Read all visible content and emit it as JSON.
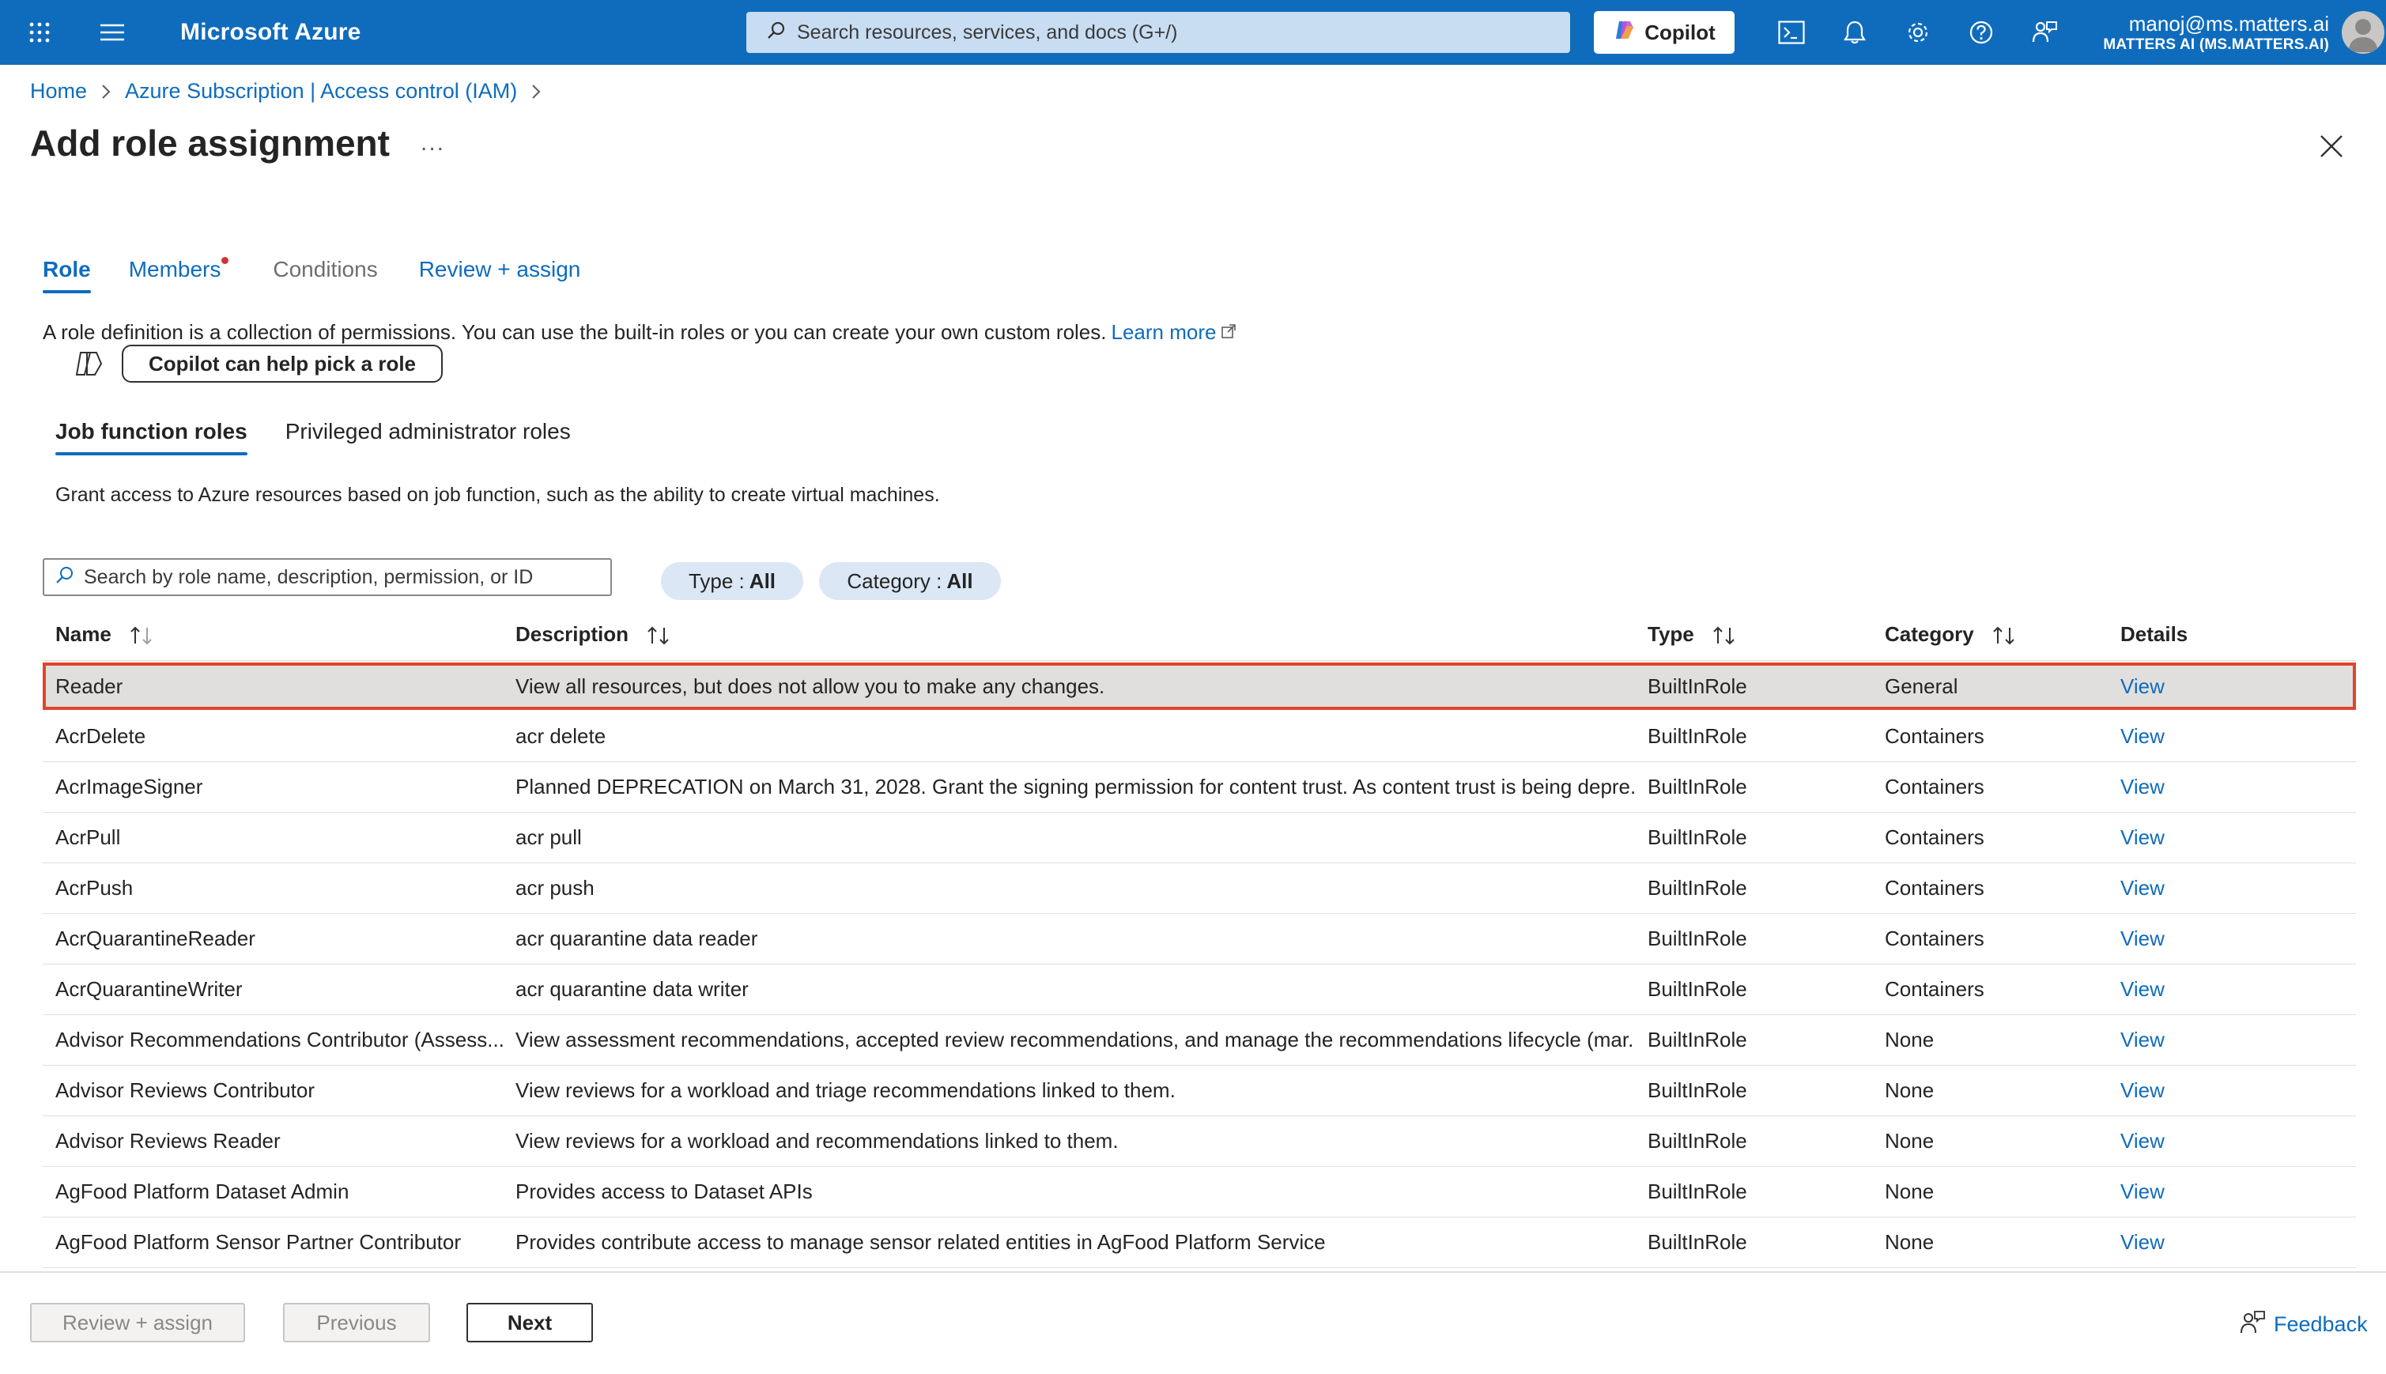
{
  "topbar": {
    "brand": "Microsoft Azure",
    "search_placeholder": "Search resources, services, and docs (G+/)",
    "copilot_label": "Copilot",
    "user_email": "manoj@ms.matters.ai",
    "user_org": "MATTERS AI (MS.MATTERS.AI)",
    "icons": [
      "apps-grid-icon",
      "hamburger-menu-icon",
      "search-icon",
      "cloud-shell-icon",
      "bell-icon",
      "gear-icon",
      "help-icon",
      "feedback-person-icon"
    ]
  },
  "breadcrumb": {
    "items": [
      "Home",
      "Azure Subscription | Access control (IAM)"
    ]
  },
  "page": {
    "title": "Add role assignment",
    "more": "..."
  },
  "tabs": [
    {
      "label": "Role",
      "state": "active"
    },
    {
      "label": "Members",
      "state": "link",
      "badge": true
    },
    {
      "label": "Conditions",
      "state": "disabled"
    },
    {
      "label": "Review + assign",
      "state": "link"
    }
  ],
  "intro": {
    "text": "A role definition is a collection of permissions. You can use the built-in roles or you can create your own custom roles.",
    "learn_more": "Learn more",
    "copilot_help": "Copilot can help pick a role"
  },
  "subtabs": [
    {
      "label": "Job function roles",
      "active": true
    },
    {
      "label": "Privileged administrator roles",
      "active": false
    }
  ],
  "grant_description": "Grant access to Azure resources based on job function, such as the ability to create virtual machines.",
  "filters": {
    "search_placeholder": "Search by role name, description, permission, or ID",
    "type_label": "Type :",
    "type_value": "All",
    "category_label": "Category :",
    "category_value": "All"
  },
  "table": {
    "headers": {
      "name": "Name",
      "description": "Description",
      "type": "Type",
      "category": "Category",
      "details": "Details"
    },
    "rows": [
      {
        "name": "Reader",
        "description": "View all resources, but does not allow you to make any changes.",
        "type": "BuiltInRole",
        "category": "General",
        "details": "View",
        "selected": true
      },
      {
        "name": "AcrDelete",
        "description": "acr delete",
        "type": "BuiltInRole",
        "category": "Containers",
        "details": "View"
      },
      {
        "name": "AcrImageSigner",
        "description": "Planned DEPRECATION on March 31, 2028. Grant the signing permission for content trust. As content trust is being depre...",
        "type": "BuiltInRole",
        "category": "Containers",
        "details": "View"
      },
      {
        "name": "AcrPull",
        "description": "acr pull",
        "type": "BuiltInRole",
        "category": "Containers",
        "details": "View"
      },
      {
        "name": "AcrPush",
        "description": "acr push",
        "type": "BuiltInRole",
        "category": "Containers",
        "details": "View"
      },
      {
        "name": "AcrQuarantineReader",
        "description": "acr quarantine data reader",
        "type": "BuiltInRole",
        "category": "Containers",
        "details": "View"
      },
      {
        "name": "AcrQuarantineWriter",
        "description": "acr quarantine data writer",
        "type": "BuiltInRole",
        "category": "Containers",
        "details": "View"
      },
      {
        "name": "Advisor Recommendations Contributor (Assess...",
        "description": "View assessment recommendations, accepted review recommendations, and manage the recommendations lifecycle (mar...",
        "type": "BuiltInRole",
        "category": "None",
        "details": "View"
      },
      {
        "name": "Advisor Reviews Contributor",
        "description": "View reviews for a workload and triage recommendations linked to them.",
        "type": "BuiltInRole",
        "category": "None",
        "details": "View"
      },
      {
        "name": "Advisor Reviews Reader",
        "description": "View reviews for a workload and recommendations linked to them.",
        "type": "BuiltInRole",
        "category": "None",
        "details": "View"
      },
      {
        "name": "AgFood Platform Dataset Admin",
        "description": "Provides access to Dataset APIs",
        "type": "BuiltInRole",
        "category": "None",
        "details": "View"
      },
      {
        "name": "AgFood Platform Sensor Partner Contributor",
        "description": "Provides contribute access to manage sensor related entities in AgFood Platform Service",
        "type": "BuiltInRole",
        "category": "None",
        "details": "View"
      }
    ]
  },
  "footer": {
    "review_assign": "Review + assign",
    "previous": "Previous",
    "next": "Next",
    "feedback": "Feedback"
  },
  "colors": {
    "brand_blue": "#0f6cbd",
    "selected_row_bg": "#e1dfdd",
    "selected_row_border": "#e0452a",
    "badge_red": "#d13438"
  }
}
